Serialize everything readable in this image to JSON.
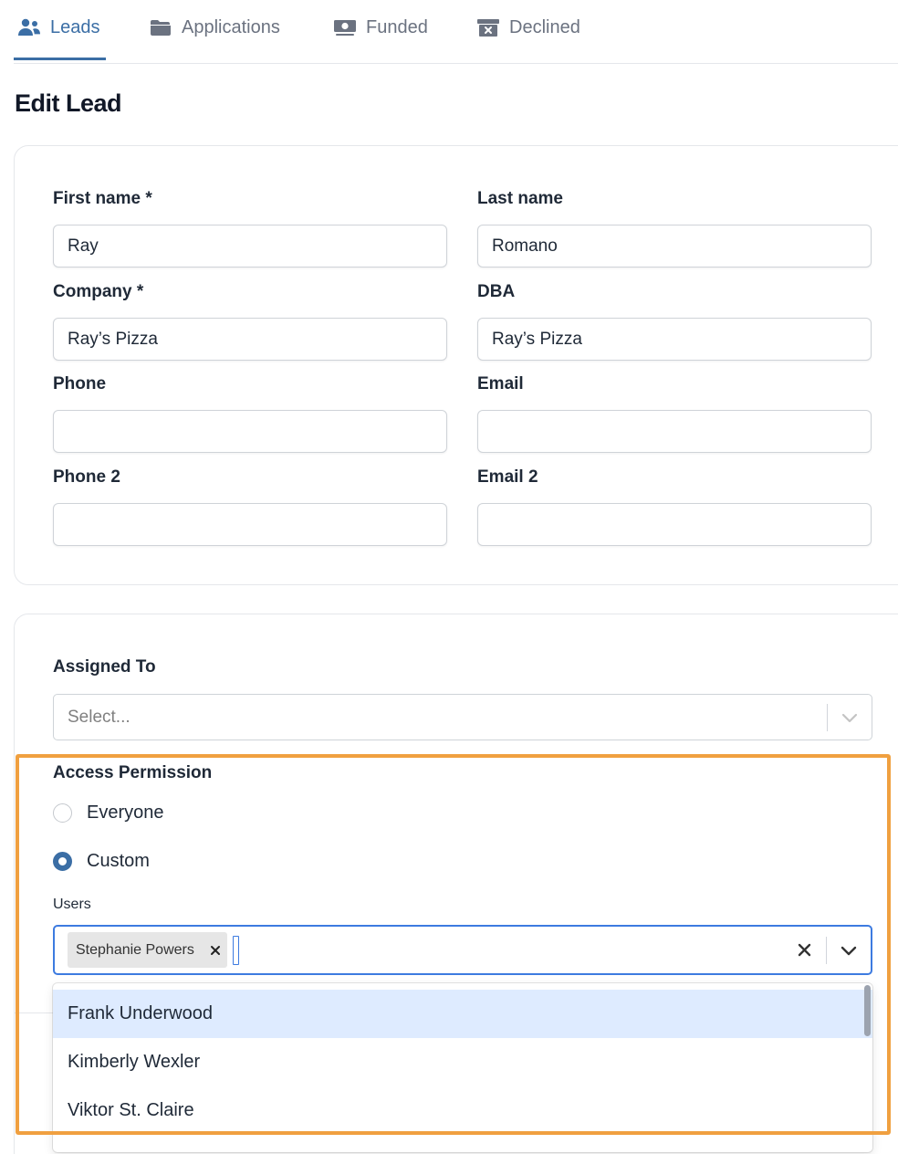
{
  "tabs": [
    {
      "label": "Leads",
      "icon": "users-icon",
      "active": true
    },
    {
      "label": "Applications",
      "icon": "folder-icon",
      "active": false
    },
    {
      "label": "Funded",
      "icon": "money-icon",
      "active": false
    },
    {
      "label": "Declined",
      "icon": "archive-x-icon",
      "active": false
    }
  ],
  "page": {
    "title": "Edit Lead"
  },
  "form": {
    "first_name": {
      "label": "First name *",
      "value": "Ray"
    },
    "last_name": {
      "label": "Last name",
      "value": "Romano"
    },
    "company": {
      "label": "Company *",
      "value": "Ray’s Pizza"
    },
    "dba": {
      "label": "DBA",
      "value": "Ray’s Pizza"
    },
    "phone": {
      "label": "Phone",
      "value": ""
    },
    "email": {
      "label": "Email",
      "value": ""
    },
    "phone2": {
      "label": "Phone 2",
      "value": ""
    },
    "email2": {
      "label": "Email 2",
      "value": ""
    }
  },
  "assigned_to": {
    "label": "Assigned To",
    "placeholder": "Select..."
  },
  "access": {
    "label": "Access Permission",
    "options": [
      {
        "label": "Everyone",
        "checked": false
      },
      {
        "label": "Custom",
        "checked": true
      }
    ],
    "users_label": "Users",
    "selected_users": [
      "Stephanie Powers"
    ],
    "remove_glyph": "×",
    "clear_glyph": "×",
    "dropdown_options": [
      "Frank Underwood",
      "Kimberly Wexler",
      "Viktor St. Claire"
    ],
    "focused_option": "Frank Underwood"
  },
  "colors": {
    "accent": "#3b6ea5",
    "focus_border": "#3d7be0",
    "option_focus": "#deebff",
    "highlight": "#f0a040"
  }
}
